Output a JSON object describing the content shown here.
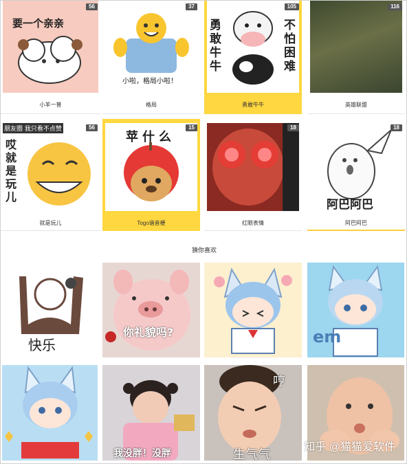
{
  "top_packs": [
    {
      "name": "小羊一普",
      "count": "56",
      "art_text": "要一个亲亲"
    },
    {
      "name": "格局",
      "count": "37",
      "art_text": "小啦，格局小啦！"
    },
    {
      "name": "勇敢牛牛",
      "count": "105",
      "art_left": "勇敢牛牛",
      "art_right": "不怕困难"
    },
    {
      "name": "英雄联盟",
      "count": "116"
    },
    {
      "name": "就是玩儿",
      "count": "56",
      "art_top": "朋友圈 我只看不点赞",
      "art_side": "哎就是玩儿"
    },
    {
      "name": "Togo谐音梗",
      "count": "15",
      "art_text": "苹什么"
    },
    {
      "name": "红眼表情",
      "count": "18"
    },
    {
      "name": "阿巴阿巴",
      "count": "18",
      "art_text": "阿巴阿巴"
    }
  ],
  "section": {
    "title": "猜你喜欢"
  },
  "recommend": [
    {
      "text": "快乐"
    },
    {
      "text": "你礼貌吗?"
    },
    {
      "text": ""
    },
    {
      "text": "em"
    },
    {
      "text": ""
    },
    {
      "text": "我没胖！没胖"
    },
    {
      "text": "生气气",
      "text2": "哼"
    },
    {
      "text": ""
    }
  ],
  "watermark": "知乎 @猫猫爱软件",
  "colors": {
    "accent": "#ffcf3a",
    "badge": "#555555"
  }
}
